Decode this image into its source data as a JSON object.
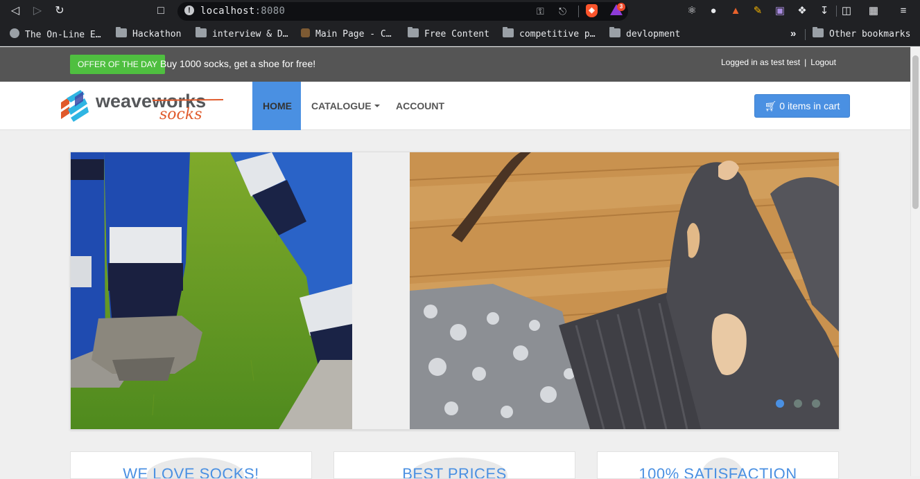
{
  "browser": {
    "url_host": "localhost",
    "url_port": ":8080",
    "brave_badge": "3",
    "icons": {
      "back": "back-icon",
      "forward": "forward-icon",
      "reload": "reload-icon",
      "bookmark": "bookmark-icon",
      "key": "key-icon",
      "share": "share-icon",
      "extensions": "puzzle-icon",
      "download": "download-icon",
      "sidebar": "sidebar-icon",
      "wallet": "wallet-icon",
      "menu": "menu-icon"
    },
    "bookmarks": [
      {
        "label": "The On-Line E…",
        "icon": "globe-icon"
      },
      {
        "label": "Hackathon",
        "icon": "folder-icon"
      },
      {
        "label": "interview & D…",
        "icon": "folder-icon"
      },
      {
        "label": "Main Page - C…",
        "icon": "page-icon"
      },
      {
        "label": "Free Content",
        "icon": "folder-icon"
      },
      {
        "label": "competitive p…",
        "icon": "folder-icon"
      },
      {
        "label": "devlopment",
        "icon": "folder-icon"
      }
    ],
    "bookmarks_more": "»",
    "other_bookmarks": "Other bookmarks"
  },
  "topbar": {
    "offer_badge": "OFFER OF THE DAY",
    "offer_text": "Buy 1000 socks, get a shoe for free!",
    "logged_in": "Logged in as test test",
    "separator": "|",
    "logout": "Logout"
  },
  "logo": {
    "main": "weaveworks",
    "sub": "socks"
  },
  "nav": {
    "home": "HOME",
    "catalogue": "CATALOGUE",
    "account": "ACCOUNT",
    "cart": "0 items in cart"
  },
  "carousel": {
    "slides": 3,
    "active_slide": 1
  },
  "features": [
    {
      "title": "WE LOVE SOCKS!"
    },
    {
      "title": "BEST PRICES"
    },
    {
      "title": "100% SATISFACTION"
    }
  ],
  "colors": {
    "accent": "#4a90e2",
    "offer_green": "#4fbf40",
    "topbar": "#555555"
  }
}
